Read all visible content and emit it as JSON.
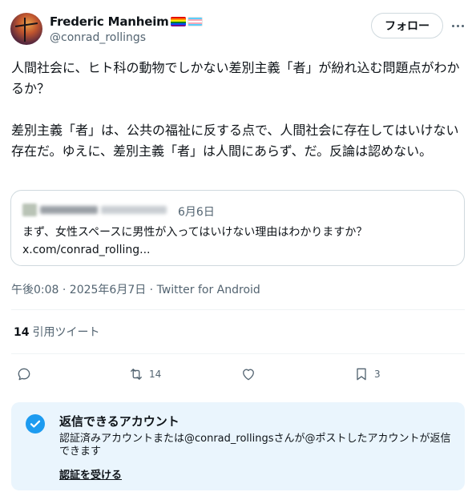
{
  "author": {
    "name": "Frederic Manheim",
    "handle": "@conrad_rollings"
  },
  "header": {
    "follow_label": "フォロー"
  },
  "tweet": {
    "paragraph1": "人間社会に、ヒト科の動物でしかない差別主義「者」が紛れ込む問題点がわかるか？",
    "paragraph2": "差別主義「者」は、公共の福祉に反する点で、人間社会に存在してはいけない存在だ。ゆえに、差別主義「者」は人間にあらず、だ。反論は認めない。"
  },
  "quote": {
    "date": "6月6日",
    "text": "まず、女性スペースに男性が入ってはいけない理由はわかりますか？",
    "link": "x.com/conrad_rolling..."
  },
  "meta": {
    "timestamp": "午後0:08 · 2025年6月7日 · Twitter for Android"
  },
  "stats": {
    "quote_count": "14",
    "quote_label": "引用ツイート"
  },
  "actions": {
    "retweet_count": "14",
    "bookmark_count": "3"
  },
  "reply_restriction": {
    "title": "返信できるアカウント",
    "description": "認証済みアカウントまたは@conrad_rollingsさんが@ポストしたアカウントが返信できます",
    "link": "認証を受ける"
  },
  "colors": {
    "text": "#0f1419",
    "muted": "#536471",
    "accent": "#1d9bf0",
    "reply_box_bg": "#eaf5fd"
  }
}
